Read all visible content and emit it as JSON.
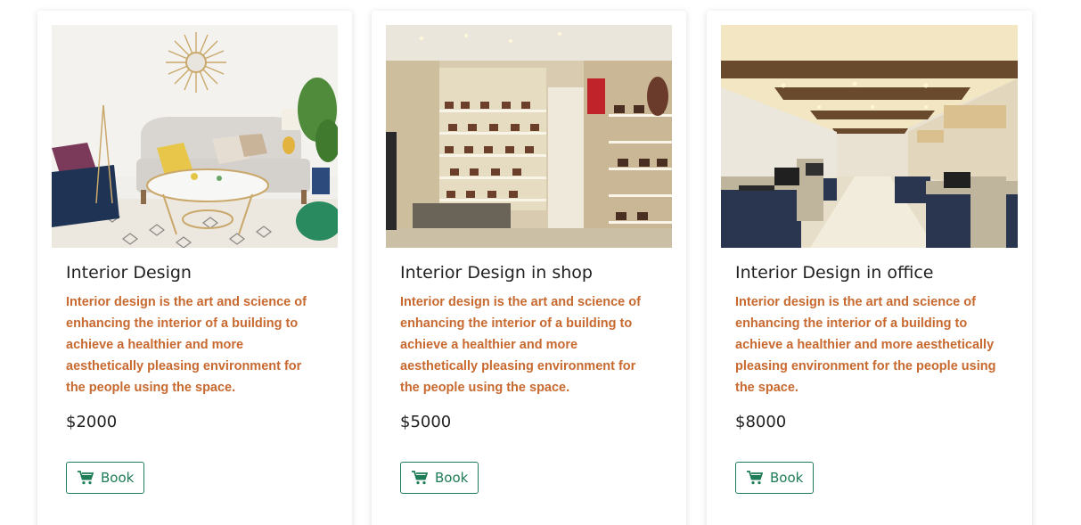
{
  "colors": {
    "accent": "#1e7d56",
    "description": "#c8692f",
    "text": "#222222"
  },
  "cards": [
    {
      "title": "Interior Design",
      "description": "Interior design is the art and science of enhancing the interior of a building to achieve a healthier and more aesthetically pleasing environment for the people using the space.",
      "price": "$2000",
      "button_label": "Book",
      "button_icon": "shopping-cart-icon"
    },
    {
      "title": "Interior Design in shop",
      "description": "Interior design is the art and science of enhancing the interior of a building to achieve a healthier and more aesthetically pleasing environment for the people using the space.",
      "price": "$5000",
      "button_label": "Book",
      "button_icon": "shopping-cart-icon"
    },
    {
      "title": "Interior Design in office",
      "description": "Interior design is the art and science of enhancing the interior of a building to achieve a healthier and more aesthetically pleasing environment for the people using the space.",
      "price": "$8000",
      "button_label": "Book",
      "button_icon": "shopping-cart-icon"
    }
  ]
}
